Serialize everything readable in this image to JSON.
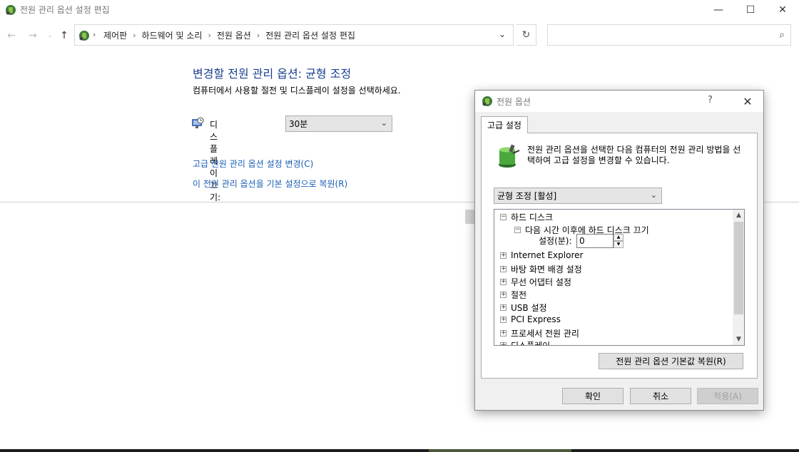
{
  "window": {
    "title": "전원 관리 옵션 설정 편집",
    "minimize_glyph": "—",
    "maximize_glyph": "☐",
    "close_glyph": "✕"
  },
  "nav": {
    "back_icon": "back-arrow-icon",
    "forward_icon": "forward-arrow-icon",
    "up_icon": "up-arrow-icon",
    "breadcrumb": [
      "제어판",
      "하드웨어 및 소리",
      "전원 옵션",
      "전원 관리 옵션 설정 편집"
    ],
    "search_placeholder": ""
  },
  "main": {
    "heading": "변경할 전원 관리 옵션: 균형 조정",
    "subtitle": "컴퓨터에서 사용할 절전 및 디스플레이 설정을 선택하세요.",
    "display_off_label": "디스플레이 끄기:",
    "display_off_value": "30분",
    "link_advanced": "고급 전원 관리 옵션 설정 변경(C)",
    "link_restore": "이 전원 관리 옵션을 기본 설정으로 복원(R)"
  },
  "dialog": {
    "title": "전원 옵션",
    "help_glyph": "?",
    "close_glyph": "✕",
    "tab_label": "고급 설정",
    "description": "전원 관리 옵션을 선택한 다음 컴퓨터의 전원 관리 방법을 선택하여 고급 설정을 변경할 수 있습니다.",
    "plan_selected": "균형 조정 [활성]",
    "tree": {
      "hard_disk": "하드 디스크",
      "hard_disk_off": "다음 시간 이후에 하드 디스크 끄기",
      "setting_label": "설정(분):",
      "setting_value": "0",
      "items": [
        "Internet Explorer",
        "바탕 화면 배경 설정",
        "무선 어댑터 설정",
        "절전",
        "USB 설정",
        "PCI Express",
        "프로세서 전원 관리",
        "디스플레이"
      ]
    },
    "restore_defaults": "전원 관리 옵션 기본값 복원(R)",
    "ok": "확인",
    "cancel": "취소",
    "apply": "적용(A)"
  },
  "colors": {
    "heading": "#1a3e8c",
    "link": "#1a5eb5",
    "dialog_bg": "#f0f0f0"
  }
}
